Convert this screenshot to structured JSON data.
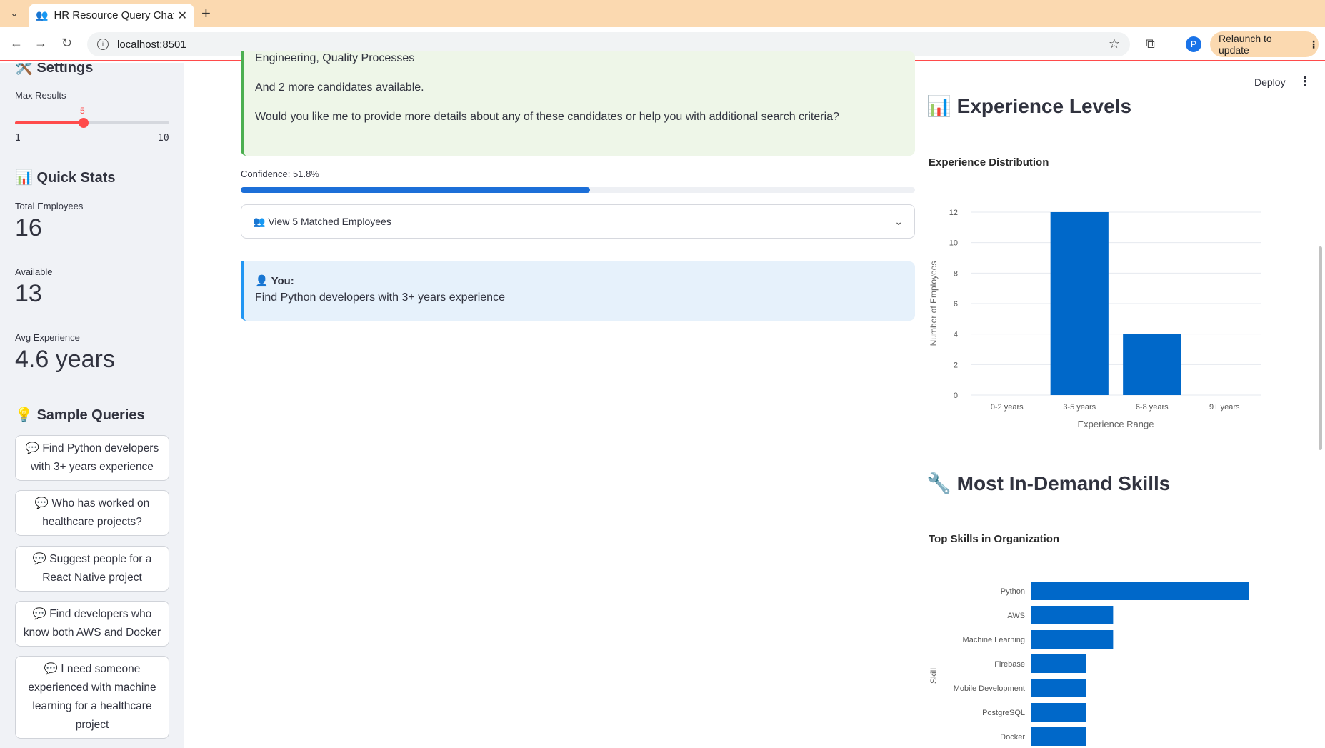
{
  "browser": {
    "tab_title": "HR Resource Query Chat",
    "tab_icon": "👥",
    "url": "localhost:8501",
    "profile_initial": "P",
    "relaunch_label": "Relaunch to update"
  },
  "sidebar": {
    "settings_heading": "🛠️ Settings",
    "max_results_label": "Max Results",
    "slider": {
      "value": "5",
      "min": "1",
      "max": "10",
      "fraction": 0.444
    },
    "stats_heading": "📊 Quick Stats",
    "stats": [
      {
        "label": "Total Employees",
        "value": "16"
      },
      {
        "label": "Available",
        "value": "13"
      },
      {
        "label": "Avg Experience",
        "value": "4.6 years"
      }
    ],
    "queries_heading": "💡 Sample Queries",
    "queries": [
      "💬 Find Python developers with 3+ years experience",
      "💬 Who has worked on healthcare projects?",
      "💬 Suggest people for a React Native project",
      "💬 Find developers who know both AWS and Docker",
      "💬 I need someone experienced with machine learning for a healthcare project"
    ]
  },
  "chat": {
    "assistant_lines": [
      "Engineering, Quality Processes",
      "And 2 more candidates available.",
      "Would you like me to provide more details about any of these candidates or help you with additional search criteria?"
    ],
    "confidence_label": "Confidence: 51.8%",
    "confidence_value": 0.518,
    "expander_label": "👥 View 5 Matched Employees",
    "user_label": "👤 You:",
    "user_message": "Find Python developers with 3+ years experience"
  },
  "header": {
    "deploy_label": "Deploy"
  },
  "right": {
    "experience_heading": "📊 Experience Levels",
    "skills_heading": "🔧 Most In-Demand Skills"
  },
  "chart_data": [
    {
      "type": "bar",
      "title": "Experience Distribution",
      "categories": [
        "0-2 years",
        "3-5 years",
        "6-8 years",
        "9+ years"
      ],
      "values": [
        0,
        12,
        4,
        0
      ],
      "xlabel": "Experience Range",
      "ylabel": "Number of Employees",
      "ylim": [
        0,
        12
      ],
      "yticks": [
        0,
        2,
        4,
        6,
        8,
        10,
        12
      ],
      "grid": true,
      "color": "#0068c9"
    },
    {
      "type": "bar",
      "orientation": "horizontal",
      "title": "Top Skills in Organization",
      "categories": [
        "Python",
        "AWS",
        "Machine Learning",
        "Firebase",
        "Mobile Development",
        "PostgreSQL",
        "Docker"
      ],
      "values": [
        8,
        3,
        3,
        2,
        2,
        2,
        2
      ],
      "ylabel": "Skill",
      "color": "#0068c9"
    }
  ]
}
